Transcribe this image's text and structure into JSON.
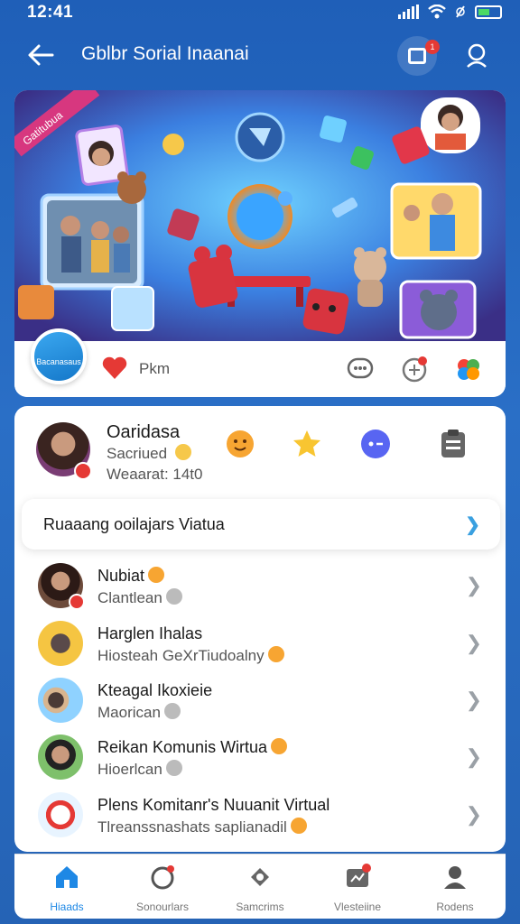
{
  "status_bar": {
    "time": "12:41"
  },
  "header": {
    "title": "Gblbr Sorial Inaanai",
    "video_badge": "1"
  },
  "hero": {
    "logo_text": "Bacanasaus",
    "ribbon_text": "Gatitubua",
    "like_text": "Pkm"
  },
  "profile": {
    "name": "Oaridasa",
    "subtitle": "Sacriued",
    "meta": "Weaarat: 14t0"
  },
  "section": {
    "title": "Ruaaang ooilajars Viatua"
  },
  "list": [
    {
      "title": "Nubiat",
      "subtitle": "Clantlean"
    },
    {
      "title": "Harglen Ihalas",
      "subtitle": "Hiosteah GeXrTiudoalny"
    },
    {
      "title": "Kteagal Ikoxieie",
      "subtitle": "Maorican"
    },
    {
      "title": "Reikan Komunis Wirtua",
      "subtitle": "Hioerlcan"
    },
    {
      "title": "Plens Komitanr's Nuuanit Virtual",
      "subtitle": "Tlreanssnashats saplianadil"
    }
  ],
  "nav": [
    {
      "label": "Hiaads",
      "icon": "home-icon"
    },
    {
      "label": "Sonourlars",
      "icon": "community-icon"
    },
    {
      "label": "Samcrims",
      "icon": "puzzle-icon"
    },
    {
      "label": "Vlesteiine",
      "icon": "video-icon"
    },
    {
      "label": "Rodens",
      "icon": "profile-icon"
    }
  ],
  "colors": {
    "accent": "#1e88e5",
    "badge": "#e53935",
    "header_bg": "#1f5fb8"
  }
}
